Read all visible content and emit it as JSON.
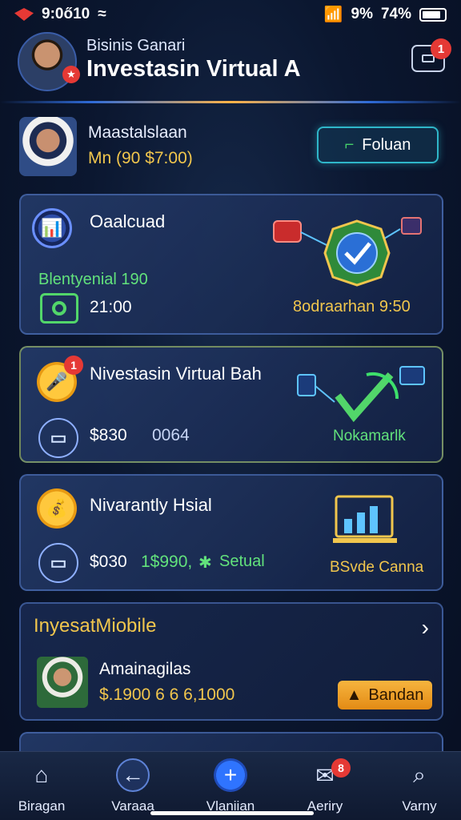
{
  "statusbar": {
    "time": "9:0ő10",
    "network": "9%",
    "battery": "74%"
  },
  "header": {
    "subtitle": "Bisinis Ganari",
    "title": "Investasin Virtual A",
    "notif_count": "1"
  },
  "profile": {
    "name": "Maastalslaan",
    "value": "Mn (90 $7:00)",
    "follow_label": "Foluan"
  },
  "card1": {
    "title": "Oaalcuad",
    "subtitle": "Blentyenial 190",
    "amount": "21:00",
    "right_label": "8odraarhan 9:50"
  },
  "card2": {
    "badge": "1",
    "title": "Nivestasin Virtual Bah",
    "amount": "$830",
    "code": "0064",
    "right_label": "Nokamarlk"
  },
  "card3": {
    "title": "Nivarantly Hsial",
    "amount": "$030",
    "amount2": "1$990,",
    "status": "Setual",
    "right_label": "BSvde Canna"
  },
  "card4": {
    "title": "InyesatMiobile",
    "name": "Amainagilas",
    "values": "$.1900 6 6 6,1000",
    "cta": "Bandan"
  },
  "nav": {
    "items": [
      {
        "label": "Biragan",
        "icon": "home-icon"
      },
      {
        "label": "Varaaa",
        "icon": "arrow-left-icon"
      },
      {
        "label": "Vlaniian",
        "icon": "plus-icon"
      },
      {
        "label": "Aeriry",
        "icon": "mail-icon",
        "badge": "8"
      },
      {
        "label": "Varny",
        "icon": "search-icon"
      }
    ]
  },
  "colors": {
    "accent": "#2f74ff",
    "gold": "#f1c64d",
    "green": "#52d66a",
    "alert": "#e53935"
  }
}
